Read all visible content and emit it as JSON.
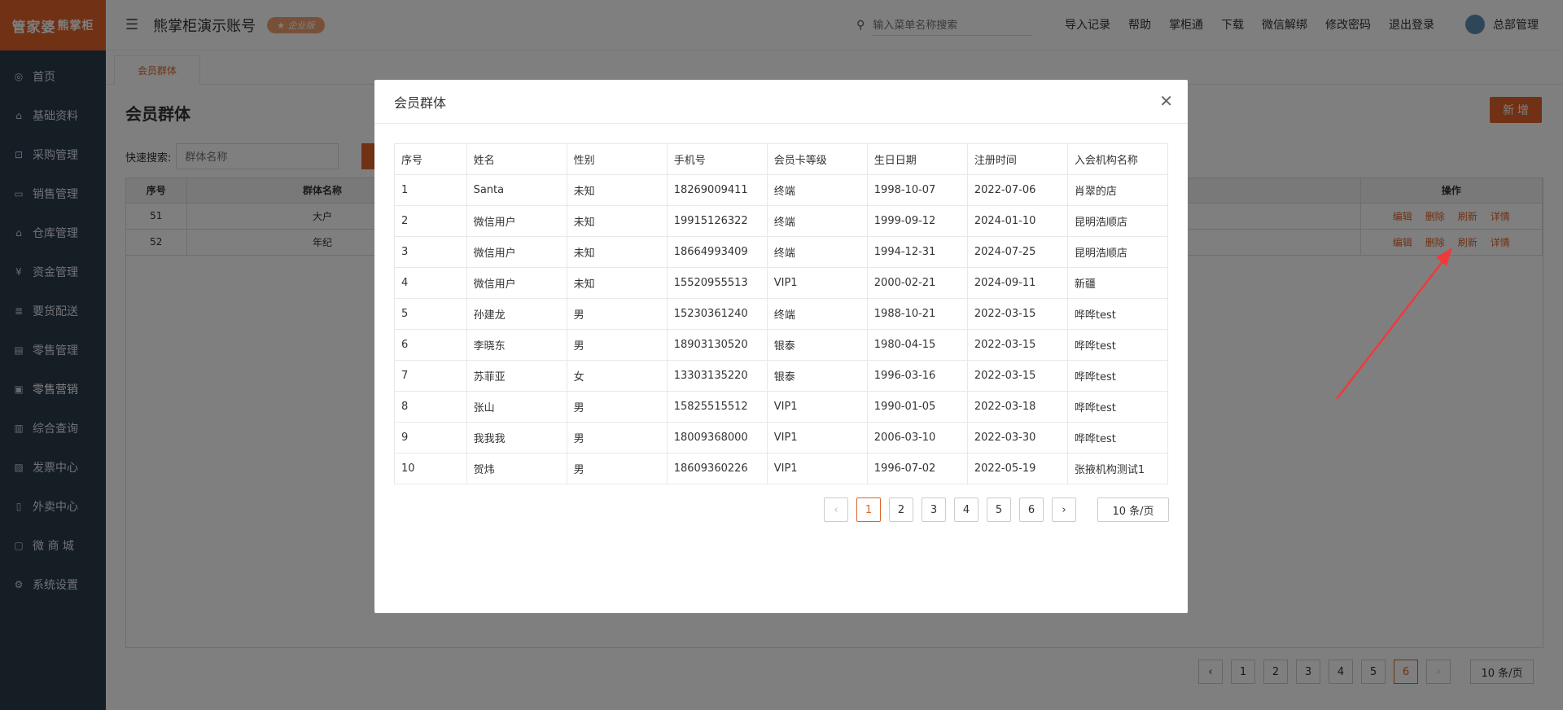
{
  "logo": {
    "text1": "管家婆",
    "text2": "熊掌柜"
  },
  "header": {
    "account": "熊掌柜演示账号",
    "badge": "企业版",
    "search_placeholder": "输入菜单名称搜索",
    "links": [
      "导入记录",
      "帮助",
      "掌柜通",
      "下载",
      "微信解绑",
      "修改密码",
      "退出登录"
    ],
    "user": "总部管理"
  },
  "sidebar": {
    "items": [
      {
        "label": "首页",
        "icon": "globe-icon"
      },
      {
        "label": "基础资料",
        "icon": "home-icon"
      },
      {
        "label": "采购管理",
        "icon": "cart-icon"
      },
      {
        "label": "销售管理",
        "icon": "card-icon"
      },
      {
        "label": "仓库管理",
        "icon": "bank-icon"
      },
      {
        "label": "资金管理",
        "icon": "money-icon"
      },
      {
        "label": "要货配送",
        "icon": "doc-icon"
      },
      {
        "label": "零售管理",
        "icon": "chart-icon"
      },
      {
        "label": "零售营销",
        "icon": "gift-icon"
      },
      {
        "label": "综合查询",
        "icon": "bar-icon"
      },
      {
        "label": "发票中心",
        "icon": "trend-icon"
      },
      {
        "label": "外卖中心",
        "icon": "phone-icon"
      },
      {
        "label": "微 商 城",
        "icon": "bag-icon"
      },
      {
        "label": "系统设置",
        "icon": "gear-icon"
      }
    ]
  },
  "tab": {
    "label": "会员群体"
  },
  "page": {
    "title": "会员群体",
    "add_label": "新 增",
    "quick_search_label": "快速搜索:",
    "quick_search_placeholder": "群体名称",
    "columns": [
      "序号",
      "群体名称",
      "操作"
    ],
    "rows": [
      {
        "no": "51",
        "name": "大户"
      },
      {
        "no": "52",
        "name": "年纪"
      }
    ],
    "ops": [
      "编辑",
      "删除",
      "刷新",
      "详情"
    ],
    "pager": {
      "pages": [
        "1",
        "2",
        "3",
        "4",
        "5",
        "6"
      ],
      "current": "6",
      "size": "10 条/页"
    }
  },
  "modal": {
    "title": "会员群体",
    "columns": [
      "序号",
      "姓名",
      "性别",
      "手机号",
      "会员卡等级",
      "生日日期",
      "注册时间",
      "入会机构名称"
    ],
    "rows": [
      [
        "1",
        "Santa",
        "未知",
        "18269009411",
        "终端",
        "1998-10-07",
        "2022-07-06",
        "肖翠的店"
      ],
      [
        "2",
        "微信用户",
        "未知",
        "19915126322",
        "终端",
        "1999-09-12",
        "2024-01-10",
        "昆明浩顺店"
      ],
      [
        "3",
        "微信用户",
        "未知",
        "18664993409",
        "终端",
        "1994-12-31",
        "2024-07-25",
        "昆明浩顺店"
      ],
      [
        "4",
        "微信用户",
        "未知",
        "15520955513",
        "VIP1",
        "2000-02-21",
        "2024-09-11",
        "新疆"
      ],
      [
        "5",
        "孙建龙",
        "男",
        "15230361240",
        "终端",
        "1988-10-21",
        "2022-03-15",
        "哗哗test"
      ],
      [
        "6",
        "李晓东",
        "男",
        "18903130520",
        "银泰",
        "1980-04-15",
        "2022-03-15",
        "哗哗test"
      ],
      [
        "7",
        "苏菲亚",
        "女",
        "13303135220",
        "银泰",
        "1996-03-16",
        "2022-03-15",
        "哗哗test"
      ],
      [
        "8",
        "张山",
        "男",
        "15825515512",
        "VIP1",
        "1990-01-05",
        "2022-03-18",
        "哗哗test"
      ],
      [
        "9",
        "我我我",
        "男",
        "18009368000",
        "VIP1",
        "2006-03-10",
        "2022-03-30",
        "哗哗test"
      ],
      [
        "10",
        "贺炜",
        "男",
        "18609360226",
        "VIP1",
        "1996-07-02",
        "2022-05-19",
        "张掖机构测试1"
      ]
    ],
    "pager": {
      "pages": [
        "1",
        "2",
        "3",
        "4",
        "5",
        "6"
      ],
      "current": "1",
      "size": "10 条/页"
    }
  },
  "colors": {
    "accent": "#e0632a",
    "sidebar": "#2b3a4a",
    "arrow": "#f03a3a"
  }
}
